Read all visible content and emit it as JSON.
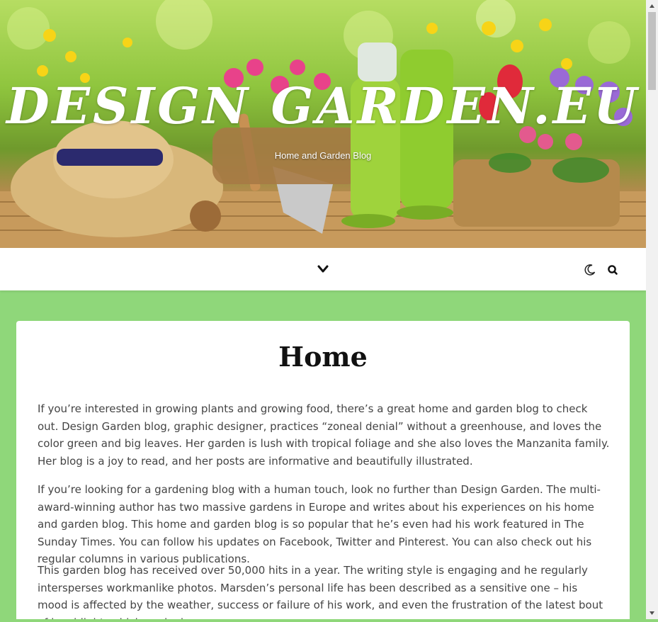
{
  "header": {
    "site_title": "DESIGN GARDEN.EU",
    "tagline": "Home and Garden Blog"
  },
  "nav": {
    "menu_toggle_icon": "chevron-down-icon",
    "dark_mode_icon": "moon-icon",
    "search_icon": "search-icon"
  },
  "colors": {
    "page_background": "#8fd77a",
    "card_background": "#ffffff",
    "title_text": "#111111",
    "body_text": "#444444"
  },
  "main": {
    "page_title": "Home",
    "paragraphs": [
      "If you’re interested in growing plants and growing food, there’s a great home and garden blog to check out. Design Garden blog, graphic designer, practices “zoneal denial” without a greenhouse, and loves the color green and big leaves. Her garden is lush with tropical foliage and she also loves the Manzanita family. Her blog is a joy to read, and her posts are informative and beautifully illustrated.",
      "If you’re looking for a gardening blog with a human touch, look no further than Design Garden. The multi-award-winning author has two massive gardens in Europe and writes about his experiences on his home and garden blog. This home and garden blog is so popular that he’s even had his work featured in The Sunday Times. You can follow his updates on Facebook, Twitter and Pinterest. You can also check out his regular columns in various publications.",
      "This garden blog has received over 50,000 hits in a year. The writing style is engaging and he regularly intersperses workmanlike photos. Marsden’s personal life has been described as a sensitive one – his mood is affected by the weather, success or failure of his work, and even the frustration of the latest bout of box blight, which evoked"
    ]
  }
}
